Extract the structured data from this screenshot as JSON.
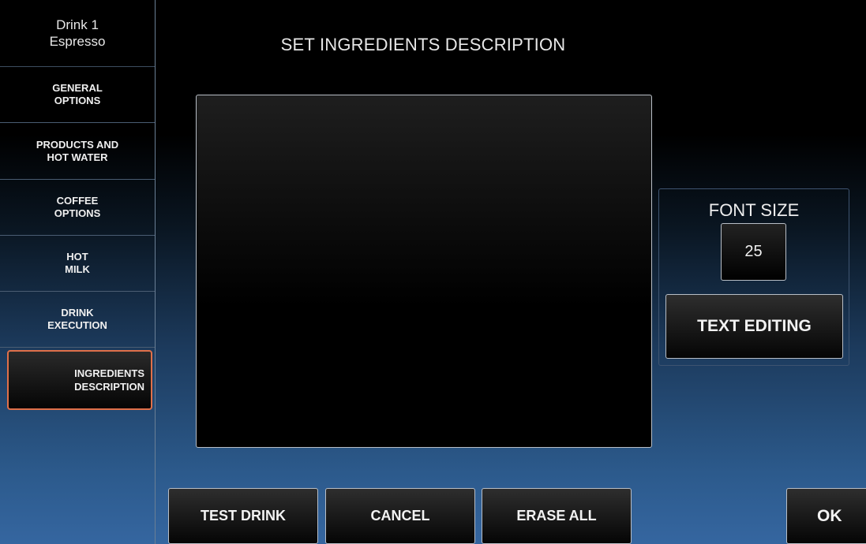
{
  "sidebar": {
    "header": {
      "line1": "Drink 1",
      "line2": "Espresso"
    },
    "items": [
      {
        "line1": "GENERAL",
        "line2": "OPTIONS"
      },
      {
        "line1": "PRODUCTS AND",
        "line2": "HOT WATER"
      },
      {
        "line1": "COFFEE",
        "line2": "OPTIONS"
      },
      {
        "line1": "HOT",
        "line2": "MILK"
      },
      {
        "line1": "DRINK",
        "line2": "EXECUTION"
      },
      {
        "line1": "INGREDIENTS",
        "line2": "DESCRIPTION",
        "active": true
      }
    ]
  },
  "main": {
    "title": "SET INGREDIENTS DESCRIPTION",
    "text_area_value": ""
  },
  "font_panel": {
    "label": "FONT SIZE",
    "value": "25",
    "text_editing_label": "TEXT EDITING"
  },
  "footer": {
    "test_drink_label": "TEST DRINK",
    "cancel_label": "CANCEL",
    "erase_all_label": "ERASE ALL",
    "ok_label": "OK"
  },
  "colors": {
    "active_border": "#e0704a",
    "button_border": "#b8bec6",
    "bottom_gradient": "#3566a0"
  }
}
